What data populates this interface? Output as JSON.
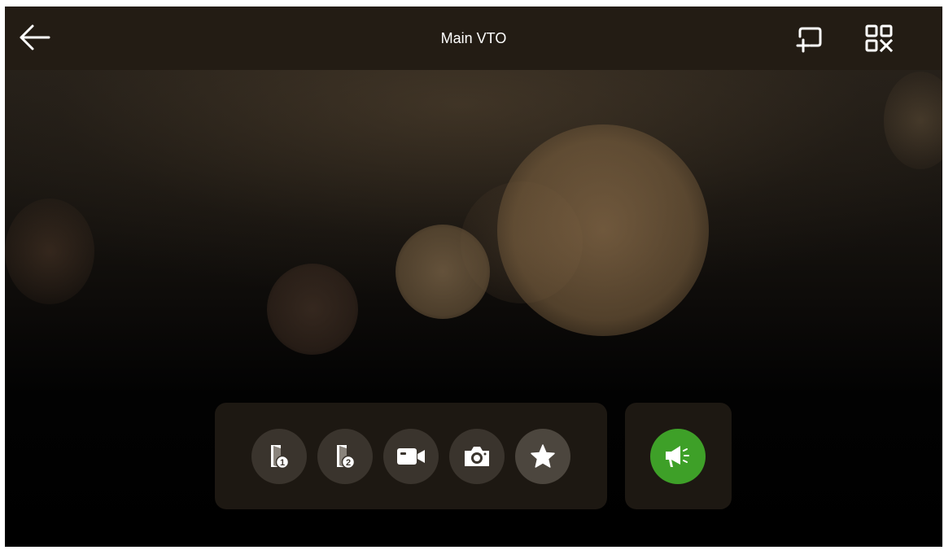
{
  "header": {
    "title": "Main VTO",
    "back_icon": "arrow-left-icon",
    "add_monitor_icon": "add-screen-icon",
    "qr_icon": "qr-code-icon"
  },
  "controls": [
    {
      "icon": "door-unlock-1-icon",
      "badge": "1"
    },
    {
      "icon": "door-unlock-2-icon",
      "badge": "2"
    },
    {
      "icon": "video-record-icon"
    },
    {
      "icon": "camera-snapshot-icon"
    },
    {
      "icon": "star-favorite-icon"
    }
  ],
  "talk": {
    "icon": "megaphone-speak-icon"
  },
  "colors": {
    "topbar": "#231c14",
    "panel": "#1d1812",
    "button": "#3a342d",
    "talk_button": "#3ea028",
    "icon": "#ffffff"
  }
}
